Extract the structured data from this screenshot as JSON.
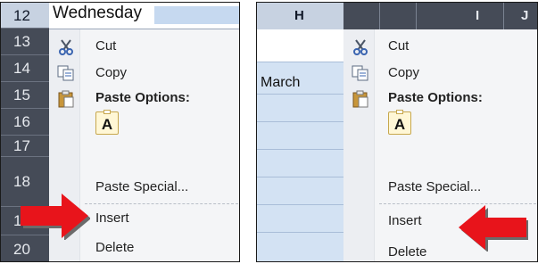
{
  "left_panel": {
    "row_numbers": [
      "12",
      "13",
      "14",
      "15",
      "16",
      "17",
      "18",
      "19",
      "20"
    ],
    "cell_text": "Wednesday",
    "menu": {
      "cut": "Cut",
      "copy": "Copy",
      "paste_options": "Paste Options:",
      "paste_icon_letter": "A",
      "paste_special": "Paste Special...",
      "insert": "Insert",
      "delete": "Delete"
    }
  },
  "right_panel": {
    "columns": [
      "H",
      "I",
      "J"
    ],
    "cell_text": "March",
    "menu": {
      "cut": "Cut",
      "copy": "Copy",
      "paste_options": "Paste Options:",
      "paste_icon_letter": "A",
      "paste_special": "Paste Special...",
      "insert": "Insert",
      "delete": "Delete"
    }
  },
  "colors": {
    "arrow": "#e8141b",
    "header_dark": "#454b57",
    "selection": "#d3e2f3"
  }
}
